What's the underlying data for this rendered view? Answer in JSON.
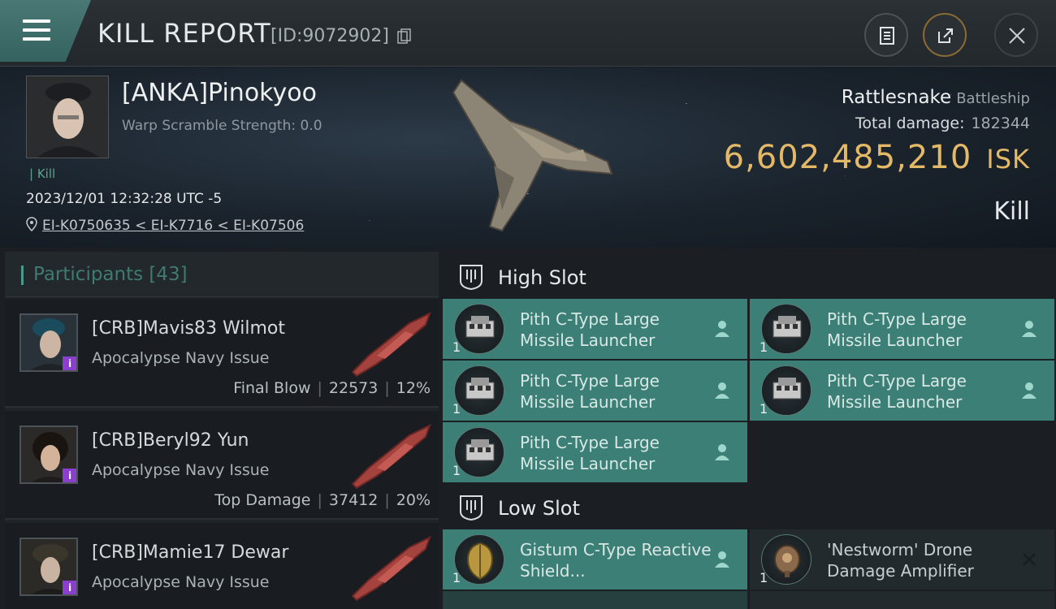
{
  "header": {
    "title": "KILL REPORT",
    "report_id": "[ID:9072902]"
  },
  "victim": {
    "name": "[ANKA]Pinokyoo",
    "warp_scramble": "Warp Scramble Strength: 0.0",
    "kill_tag": "Kill",
    "timestamp": "2023/12/01 12:32:28 UTC -5",
    "location": "EI-K0750635 < EI-K7716 < EI-K07506",
    "ship_name": "Rattlesnake",
    "ship_class": "Battleship",
    "total_damage_label": "Total damage:",
    "total_damage": "182344",
    "isk_value": "6,602,485,210",
    "isk_unit": "ISK",
    "result": "Kill"
  },
  "participants": {
    "label": "Participants",
    "count": "[43]",
    "items": [
      {
        "name": "[CRB]Mavis83 Wilmot",
        "ship": "Apocalypse Navy Issue",
        "tag": "Final Blow",
        "damage": "22573",
        "pct": "12%"
      },
      {
        "name": "[CRB]Beryl92 Yun",
        "ship": "Apocalypse Navy Issue",
        "tag": "Top Damage",
        "damage": "37412",
        "pct": "20%"
      },
      {
        "name": "[CRB]Mamie17 Dewar",
        "ship": "Apocalypse Navy Issue",
        "tag": "",
        "damage": "",
        "pct": ""
      }
    ]
  },
  "slots": {
    "high": {
      "label": "High Slot",
      "modules": [
        {
          "name": "Pith C-Type Large Missile Launcher",
          "qty": "1"
        },
        {
          "name": "Pith C-Type Large Missile Launcher",
          "qty": "1"
        },
        {
          "name": "Pith C-Type Large Missile Launcher",
          "qty": "1"
        },
        {
          "name": "Pith C-Type Large Missile Launcher",
          "qty": "1"
        },
        {
          "name": "Pith C-Type Large Missile Launcher",
          "qty": "1"
        }
      ]
    },
    "low": {
      "label": "Low Slot",
      "modules": [
        {
          "name": "Gistum C-Type Reactive Shield...",
          "qty": "1",
          "status": "dropped"
        },
        {
          "name": "'Nestworm' Drone Damage Amplifier",
          "qty": "1",
          "status": "destroyed"
        }
      ]
    }
  },
  "colors": {
    "accent_teal": "#3c7f76",
    "isk_gold": "#e3b866",
    "badge_purple": "#8a3fcf",
    "kill_green": "#5da38c"
  },
  "icons": [
    "menu-icon",
    "copy-icon",
    "clipboard-icon",
    "export-icon",
    "close-icon",
    "location-pin-icon",
    "high-slot-icon",
    "low-slot-icon",
    "pilot-icon",
    "cross-icon"
  ]
}
